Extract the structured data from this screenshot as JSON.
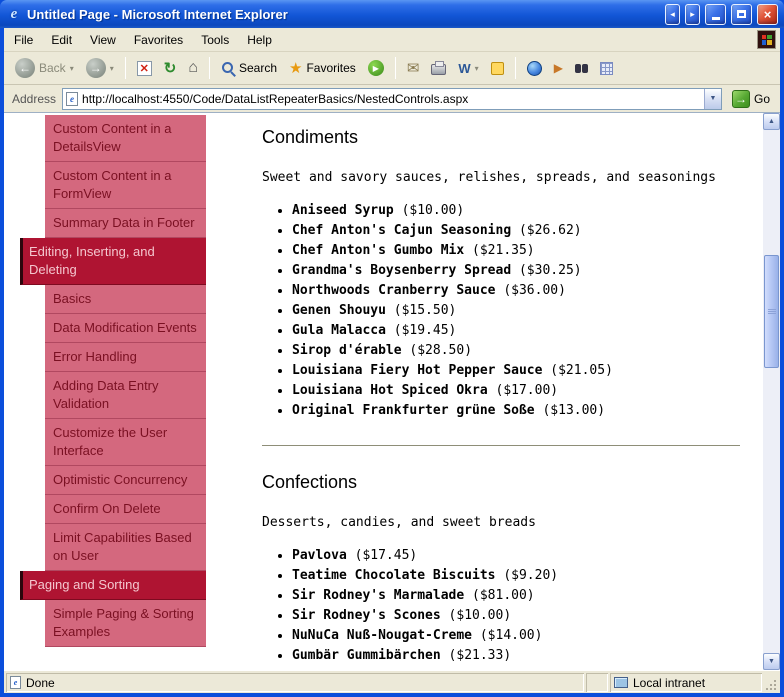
{
  "window": {
    "title": "Untitled Page - Microsoft Internet Explorer"
  },
  "menu": {
    "items": [
      "File",
      "Edit",
      "View",
      "Favorites",
      "Tools",
      "Help"
    ]
  },
  "toolbar": {
    "back_label": "Back",
    "search_label": "Search",
    "favorites_label": "Favorites",
    "edit_label": "W"
  },
  "address": {
    "label": "Address",
    "url": "http://localhost:4550/Code/DataListRepeaterBasics/NestedControls.aspx",
    "go_label": "Go"
  },
  "sidebar": {
    "items": [
      {
        "label": "Custom Content in a DetailsView",
        "type": "item"
      },
      {
        "label": "Custom Content in a FormView",
        "type": "item"
      },
      {
        "label": "Summary Data in Footer",
        "type": "item"
      },
      {
        "label": "Editing, Inserting, and Deleting",
        "type": "header"
      },
      {
        "label": "Basics",
        "type": "item"
      },
      {
        "label": "Data Modification Events",
        "type": "item"
      },
      {
        "label": "Error Handling",
        "type": "item"
      },
      {
        "label": "Adding Data Entry Validation",
        "type": "item"
      },
      {
        "label": "Customize the User Interface",
        "type": "item"
      },
      {
        "label": "Optimistic Concurrency",
        "type": "item"
      },
      {
        "label": "Confirm On Delete",
        "type": "item"
      },
      {
        "label": "Limit Capabilities Based on User",
        "type": "item"
      },
      {
        "label": "Paging and Sorting",
        "type": "header"
      },
      {
        "label": "Simple Paging & Sorting Examples",
        "type": "item"
      }
    ]
  },
  "content": {
    "sections": [
      {
        "title": "Condiments",
        "description": "Sweet and savory sauces, relishes, spreads, and seasonings",
        "products": [
          {
            "name": "Aniseed Syrup",
            "price": "($10.00)"
          },
          {
            "name": "Chef Anton's Cajun Seasoning",
            "price": "($26.62)"
          },
          {
            "name": "Chef Anton's Gumbo Mix",
            "price": "($21.35)"
          },
          {
            "name": "Grandma's Boysenberry Spread",
            "price": "($30.25)"
          },
          {
            "name": "Northwoods Cranberry Sauce",
            "price": "($36.00)"
          },
          {
            "name": "Genen Shouyu",
            "price": "($15.50)"
          },
          {
            "name": "Gula Malacca",
            "price": "($19.45)"
          },
          {
            "name": "Sirop d'érable",
            "price": "($28.50)"
          },
          {
            "name": "Louisiana Fiery Hot Pepper Sauce",
            "price": "($21.05)"
          },
          {
            "name": "Louisiana Hot Spiced Okra",
            "price": "($17.00)"
          },
          {
            "name": "Original Frankfurter grüne Soße",
            "price": "($13.00)"
          }
        ]
      },
      {
        "title": "Confections",
        "description": "Desserts, candies, and sweet breads",
        "products": [
          {
            "name": "Pavlova",
            "price": "($17.45)"
          },
          {
            "name": "Teatime Chocolate Biscuits",
            "price": "($9.20)"
          },
          {
            "name": "Sir Rodney's Marmalade",
            "price": "($81.00)"
          },
          {
            "name": "Sir Rodney's Scones",
            "price": "($10.00)"
          },
          {
            "name": "NuNuCa Nuß-Nougat-Creme",
            "price": "($14.00)"
          },
          {
            "name": "Gumbär Gummibärchen",
            "price": "($21.33)"
          }
        ]
      }
    ]
  },
  "statusbar": {
    "status": "Done",
    "zone": "Local intranet"
  },
  "theme": {
    "titlebar_blue": "#1256D6",
    "chrome_tan": "#ECE9D8",
    "sidebar_header_bg": "#AF1432",
    "sidebar_header_text": "#F4C6CE",
    "sidebar_item_bg": "#D4687E",
    "sidebar_item_text": "#7A1022",
    "content_bg": "#FFFFFF"
  }
}
